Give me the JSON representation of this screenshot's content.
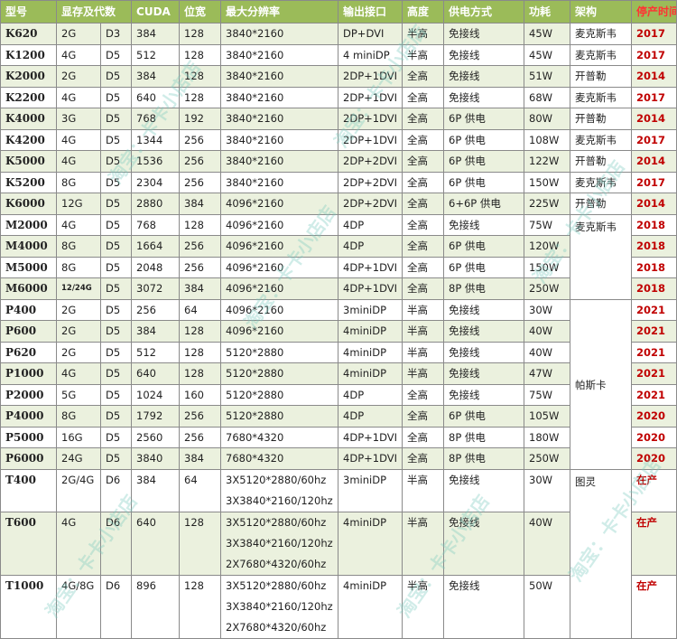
{
  "headers": [
    "型号",
    "显存及代数",
    "",
    "CUDA",
    "位宽",
    "最大分辨率",
    "输出接口",
    "高度",
    "供电方式",
    "功耗",
    "架构",
    "停产时间"
  ],
  "rows": [
    {
      "model": "K620",
      "mem": "2G",
      "gen": "D3",
      "cuda": "384",
      "bus": "128",
      "res": [
        "3840*2160"
      ],
      "out": "DP+DVI",
      "height": "半高",
      "power": "免接线",
      "tdp": "45W",
      "year": "2017"
    },
    {
      "model": "K1200",
      "mem": "4G",
      "gen": "D5",
      "cuda": "512",
      "bus": "128",
      "res": [
        "3840*2160"
      ],
      "out": "4 miniDP",
      "height": "半高",
      "power": "免接线",
      "tdp": "45W",
      "year": "2017"
    },
    {
      "model": "K2000",
      "mem": "2G",
      "gen": "D5",
      "cuda": "384",
      "bus": "128",
      "res": [
        "3840*2160"
      ],
      "out": "2DP+1DVI",
      "height": "全高",
      "power": "免接线",
      "tdp": "51W",
      "year": "2014"
    },
    {
      "model": "K2200",
      "mem": "4G",
      "gen": "D5",
      "cuda": "640",
      "bus": "128",
      "res": [
        "3840*2160"
      ],
      "out": "2DP+1DVI",
      "height": "全高",
      "power": "免接线",
      "tdp": "68W",
      "year": "2017"
    },
    {
      "model": "K4000",
      "mem": "3G",
      "gen": "D5",
      "cuda": "768",
      "bus": "192",
      "res": [
        "3840*2160"
      ],
      "out": "2DP+1DVI",
      "height": "全高",
      "power": "6P 供电",
      "tdp": "80W",
      "year": "2014"
    },
    {
      "model": "K4200",
      "mem": "4G",
      "gen": "D5",
      "cuda": "1344",
      "bus": "256",
      "res": [
        "3840*2160"
      ],
      "out": "2DP+1DVI",
      "height": "全高",
      "power": "6P 供电",
      "tdp": "108W",
      "year": "2017"
    },
    {
      "model": "K5000",
      "mem": "4G",
      "gen": "D5",
      "cuda": "1536",
      "bus": "256",
      "res": [
        "3840*2160"
      ],
      "out": "2DP+2DVI",
      "height": "全高",
      "power": "6P 供电",
      "tdp": "122W",
      "year": "2014"
    },
    {
      "model": "K5200",
      "mem": "8G",
      "gen": "D5",
      "cuda": "2304",
      "bus": "256",
      "res": [
        "3840*2160"
      ],
      "out": "2DP+2DVI",
      "height": "全高",
      "power": "6P 供电",
      "tdp": "150W",
      "year": "2017"
    },
    {
      "model": "K6000",
      "mem": "12G",
      "gen": "D5",
      "cuda": "2880",
      "bus": "384",
      "res": [
        "4096*2160"
      ],
      "out": "2DP+2DVI",
      "height": "全高",
      "power": "6+6P 供电",
      "tdp": "225W",
      "year": "2014"
    },
    {
      "model": "M2000",
      "mem": "4G",
      "gen": "D5",
      "cuda": "768",
      "bus": "128",
      "res": [
        "4096*2160"
      ],
      "out": "4DP",
      "height": "全高",
      "power": "免接线",
      "tdp": "75W",
      "year": "2018"
    },
    {
      "model": "M4000",
      "mem": "8G",
      "gen": "D5",
      "cuda": "1664",
      "bus": "256",
      "res": [
        "4096*2160"
      ],
      "out": "4DP",
      "height": "全高",
      "power": "6P 供电",
      "tdp": "120W",
      "year": "2018"
    },
    {
      "model": "M5000",
      "mem": "8G",
      "gen": "D5",
      "cuda": "2048",
      "bus": "256",
      "res": [
        "4096*2160"
      ],
      "out": "4DP+1DVI",
      "height": "全高",
      "power": "6P 供电",
      "tdp": "150W",
      "year": "2018"
    },
    {
      "model": "M6000",
      "mem": "12/24G",
      "gen": "D5",
      "cuda": "3072",
      "bus": "384",
      "res": [
        "4096*2160"
      ],
      "out": "4DP+1DVI",
      "height": "全高",
      "power": "8P 供电",
      "tdp": "250W",
      "year": "2018"
    },
    {
      "model": "P400",
      "mem": "2G",
      "gen": "D5",
      "cuda": "256",
      "bus": "64",
      "res": [
        "4096*2160"
      ],
      "out": "3miniDP",
      "height": "半高",
      "power": "免接线",
      "tdp": "30W",
      "year": "2021"
    },
    {
      "model": "P600",
      "mem": "2G",
      "gen": "D5",
      "cuda": "384",
      "bus": "128",
      "res": [
        "4096*2160"
      ],
      "out": "4miniDP",
      "height": "半高",
      "power": "免接线",
      "tdp": "40W",
      "year": "2021"
    },
    {
      "model": "P620",
      "mem": "2G",
      "gen": "D5",
      "cuda": "512",
      "bus": "128",
      "res": [
        "5120*2880"
      ],
      "out": "4miniDP",
      "height": "半高",
      "power": "免接线",
      "tdp": "40W",
      "year": "2021"
    },
    {
      "model": "P1000",
      "mem": "4G",
      "gen": "D5",
      "cuda": "640",
      "bus": "128",
      "res": [
        "5120*2880"
      ],
      "out": "4miniDP",
      "height": "半高",
      "power": "免接线",
      "tdp": "47W",
      "year": "2021"
    },
    {
      "model": "P2000",
      "mem": "5G",
      "gen": "D5",
      "cuda": "1024",
      "bus": "160",
      "res": [
        "5120*2880"
      ],
      "out": "4DP",
      "height": "全高",
      "power": "免接线",
      "tdp": "75W",
      "year": "2021"
    },
    {
      "model": "P4000",
      "mem": "8G",
      "gen": "D5",
      "cuda": "1792",
      "bus": "256",
      "res": [
        "5120*2880"
      ],
      "out": "4DP",
      "height": "全高",
      "power": "6P 供电",
      "tdp": "105W",
      "year": "2020"
    },
    {
      "model": "P5000",
      "mem": "16G",
      "gen": "D5",
      "cuda": "2560",
      "bus": "256",
      "res": [
        "7680*4320"
      ],
      "out": "4DP+1DVI",
      "height": "全高",
      "power": "8P 供电",
      "tdp": "180W",
      "year": "2020"
    },
    {
      "model": "P6000",
      "mem": "24G",
      "gen": "D5",
      "cuda": "3840",
      "bus": "384",
      "res": [
        "7680*4320"
      ],
      "out": "4DP+1DVI",
      "height": "全高",
      "power": "8P 供电",
      "tdp": "250W",
      "year": "2020"
    },
    {
      "model": "T400",
      "mem": "2G/4G",
      "gen": "D6",
      "cuda": "384",
      "bus": "64",
      "res": [
        "3X5120*2880/60hz",
        "3X3840*2160/120hz"
      ],
      "out": "3miniDP",
      "height": "半高",
      "power": "免接线",
      "tdp": "30W",
      "year": "在产"
    },
    {
      "model": "T600",
      "mem": "4G",
      "gen": "D6",
      "cuda": "640",
      "bus": "128",
      "res": [
        "3X5120*2880/60hz",
        "3X3840*2160/120hz",
        "2X7680*4320/60hz"
      ],
      "out": "4miniDP",
      "height": "半高",
      "power": "免接线",
      "tdp": "40W",
      "year": "在产"
    },
    {
      "model": "T1000",
      "mem": "4G/8G",
      "gen": "D6",
      "cuda": "896",
      "bus": "128",
      "res": [
        "3X5120*2880/60hz",
        "3X3840*2160/120hz",
        "2X7680*4320/60hz"
      ],
      "out": "4miniDP",
      "height": "半高",
      "power": "免接线",
      "tdp": "50W",
      "year": "在产"
    }
  ],
  "arch_groups": [
    {
      "label": "麦克斯韦",
      "start": 0,
      "span": 1
    },
    {
      "label": "麦克斯韦",
      "start": 1,
      "span": 1
    },
    {
      "label": "开普勒",
      "start": 2,
      "span": 1
    },
    {
      "label": "麦克斯韦",
      "start": 3,
      "span": 1
    },
    {
      "label": "开普勒",
      "start": 4,
      "span": 1
    },
    {
      "label": "麦克斯韦",
      "start": 5,
      "span": 1
    },
    {
      "label": "开普勒",
      "start": 6,
      "span": 1
    },
    {
      "label": "麦克斯韦",
      "start": 7,
      "span": 1
    },
    {
      "label": "开普勒",
      "start": 8,
      "span": 1
    },
    {
      "label": "麦克斯韦",
      "start": 9,
      "span": 4
    },
    {
      "label": "帕斯卡",
      "start": 13,
      "span": 8
    },
    {
      "label": "图灵",
      "start": 21,
      "span": 3
    }
  ],
  "watermark": "淘宝：卡卡小店店",
  "colors": {
    "header_bg": "#9bbb59",
    "alt_row": "#ebf1de",
    "year_red": "#c00000",
    "stop_header": "#ff3333"
  }
}
